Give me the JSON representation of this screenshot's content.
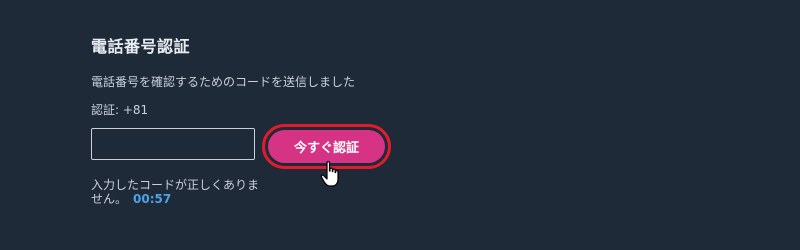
{
  "dialog": {
    "title": "電話番号認証",
    "description": "電話番号を確認するためのコードを送信しました",
    "phone_label": "認証: +81",
    "code_input_value": "",
    "code_input_placeholder": "",
    "verify_button_label": "今すぐ認証",
    "error_message": "入力したコードが正しくありません。",
    "timer": "00:57"
  },
  "colors": {
    "background": "#1e2a38",
    "button": "#d63384",
    "highlight_ring": "#e01c2c",
    "timer": "#4aa3e8"
  },
  "icons": {
    "cursor": "hand-pointer-icon"
  }
}
